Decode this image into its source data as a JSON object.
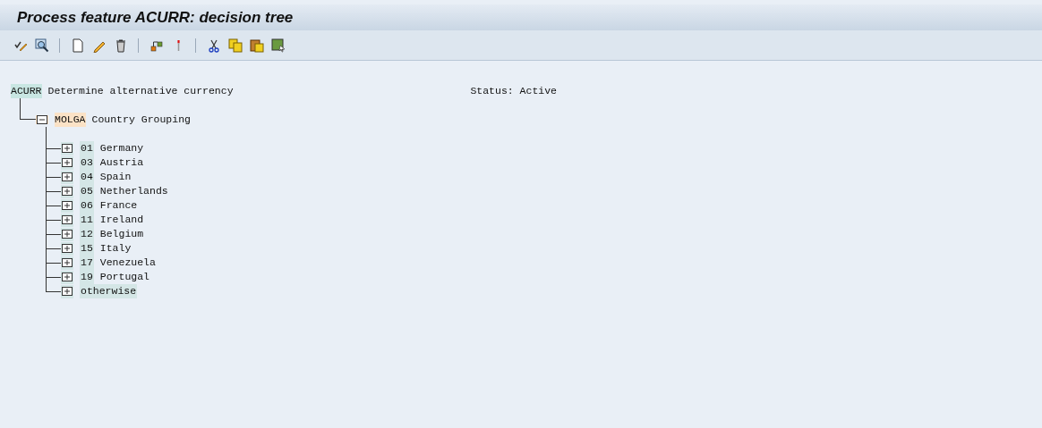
{
  "window": {
    "title": "Process feature ACURR: decision tree"
  },
  "toolbar": [
    [
      {
        "kind": "check"
      },
      {
        "kind": "display"
      }
    ],
    [
      {
        "kind": "new"
      },
      {
        "kind": "edit"
      },
      {
        "kind": "delete"
      }
    ],
    [
      {
        "kind": "hierarchy"
      },
      {
        "kind": "marker"
      }
    ],
    [
      {
        "kind": "cut"
      },
      {
        "kind": "copy"
      },
      {
        "kind": "paste"
      },
      {
        "kind": "screen"
      }
    ]
  ],
  "tree": {
    "key": "ACURR",
    "text": "Determine alternative currency",
    "status": "Status: Active",
    "children": [
      {
        "key": "MOLGA",
        "text": "Country Grouping",
        "expanded": true,
        "children": [
          {
            "key": "01",
            "text": "Germany",
            "expanded": false
          },
          {
            "key": "03",
            "text": "Austria",
            "expanded": false
          },
          {
            "key": "04",
            "text": "Spain",
            "expanded": false
          },
          {
            "key": "05",
            "text": "Netherlands",
            "expanded": false
          },
          {
            "key": "06",
            "text": "France",
            "expanded": false
          },
          {
            "key": "11",
            "text": "Ireland",
            "expanded": false
          },
          {
            "key": "12",
            "text": "Belgium",
            "expanded": false
          },
          {
            "key": "15",
            "text": "Italy",
            "expanded": false
          },
          {
            "key": "17",
            "text": "Venezuela",
            "expanded": false
          },
          {
            "key": "19",
            "text": "Portugal",
            "expanded": false
          },
          {
            "key": "otherwise",
            "expanded": false
          }
        ]
      }
    ]
  }
}
